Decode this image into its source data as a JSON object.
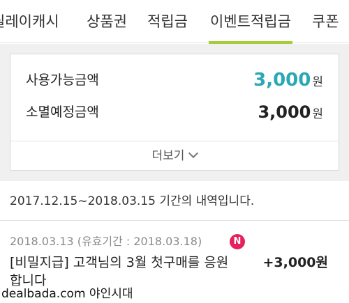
{
  "tabs": [
    {
      "label": "릴레이캐시"
    },
    {
      "label": "상품권"
    },
    {
      "label": "적립금"
    },
    {
      "label": "이벤트적립금",
      "active": true
    },
    {
      "label": "쿠폰"
    }
  ],
  "colors": {
    "accent_tab_underline": "#a5cc3a",
    "available_amount": "#29a8b5",
    "new_badge": "#e5225d"
  },
  "summary": {
    "available_label": "사용가능금액",
    "available_amount": "3,000",
    "available_unit": "원",
    "expiring_label": "소멸예정금액",
    "expiring_amount": "3,000",
    "expiring_unit": "원",
    "more_label": "더보기",
    "more_icon": "chevron-down-icon"
  },
  "period": {
    "text": "2017.12.15~2018.03.15 기간의 내역입니다."
  },
  "history": [
    {
      "meta": "2018.03.13 (유효기간 : 2018.03.18)",
      "badge": "N",
      "title": "[비밀지급] 고객님의 3월 첫구매를 응원합니다",
      "amount": "+3,000원"
    }
  ],
  "watermark": "dealbada.com 야인시대"
}
